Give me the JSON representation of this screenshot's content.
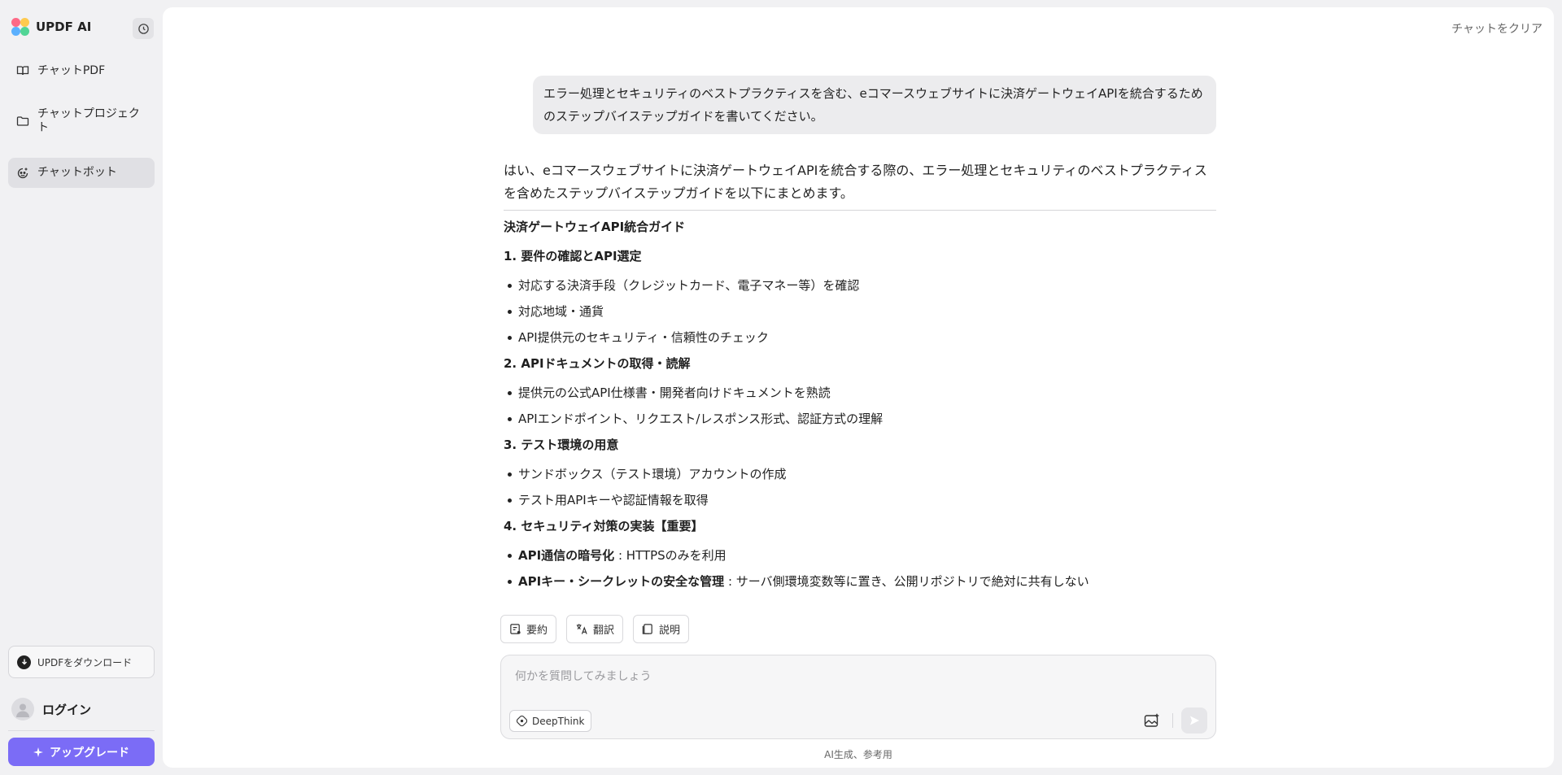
{
  "app": {
    "name": "UPDF AI"
  },
  "sidebar": {
    "items": [
      {
        "label": "チャットPDF",
        "icon": "book-open-icon"
      },
      {
        "label": "チャットプロジェクト",
        "icon": "folder-icon"
      },
      {
        "label": "チャットボット",
        "icon": "bot-icon",
        "active": true
      }
    ],
    "download_label": "UPDFをダウンロード",
    "login_label": "ログイン",
    "upgrade_label": "アップグレード"
  },
  "header": {
    "clear_chat_label": "チャットをクリア"
  },
  "conversation": {
    "user_message": "エラー処理とセキュリティのベストプラクティスを含む、eコマースウェブサイトに決済ゲートウェイAPIを統合するためのステップバイステップガイドを書いてください。",
    "assistant": {
      "intro": "はい、eコマースウェブサイトに決済ゲートウェイAPIを統合する際の、エラー処理とセキュリティのベストプラクティスを含めたステップバイステップガイドを以下にまとめます。",
      "title": "決済ゲートウェイAPI統合ガイド",
      "sections": [
        {
          "heading": "1. 要件の確認とAPI選定",
          "items": [
            {
              "bold": "",
              "text": "対応する決済手段（クレジットカード、電子マネー等）を確認"
            },
            {
              "bold": "",
              "text": "対応地域・通貨"
            },
            {
              "bold": "",
              "text": "API提供元のセキュリティ・信頼性のチェック"
            }
          ]
        },
        {
          "heading": "2. APIドキュメントの取得・読解",
          "items": [
            {
              "bold": "",
              "text": "提供元の公式API仕様書・開発者向けドキュメントを熟読"
            },
            {
              "bold": "",
              "text": "APIエンドポイント、リクエスト/レスポンス形式、認証方式の理解"
            }
          ]
        },
        {
          "heading": "3. テスト環境の用意",
          "items": [
            {
              "bold": "",
              "text": "サンドボックス（テスト環境）アカウントの作成"
            },
            {
              "bold": "",
              "text": "テスト用APIキーや認証情報を取得"
            }
          ]
        },
        {
          "heading": "4. セキュリティ対策の実装【重要】",
          "items": [
            {
              "bold": "API通信の暗号化",
              "text": " : HTTPSのみを利用"
            },
            {
              "bold": "APIキー・シークレットの安全な管理",
              "text": " : サーバ側環境変数等に置き、公開リポジトリで絶対に共有しない"
            }
          ]
        }
      ]
    }
  },
  "actions": [
    {
      "label": "要約",
      "icon": "summary-icon"
    },
    {
      "label": "翻訳",
      "icon": "translate-icon"
    },
    {
      "label": "説明",
      "icon": "explain-icon"
    }
  ],
  "composer": {
    "placeholder": "何かを質問してみましょう",
    "deepthink_label": "DeepThink"
  },
  "footer": {
    "note": "AI生成、参考用"
  }
}
